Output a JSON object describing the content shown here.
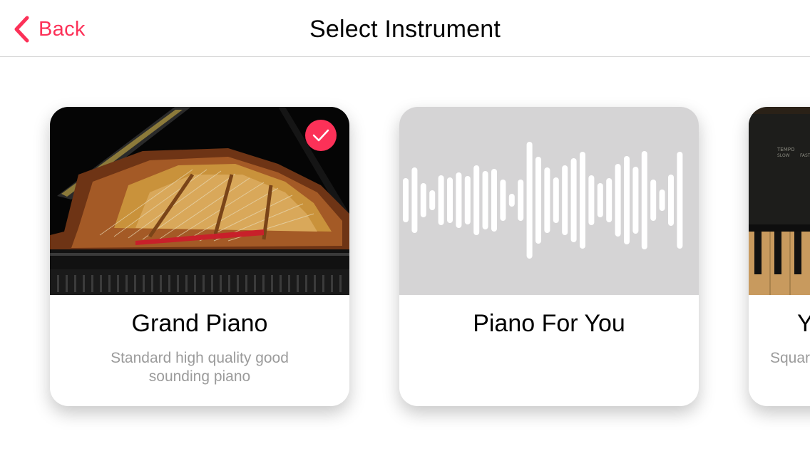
{
  "nav": {
    "back_label": "Back",
    "title": "Select Instrument"
  },
  "cards": [
    {
      "title": "Grand Piano",
      "description": "Standard high quality good sounding piano",
      "media": "grand-piano-photo",
      "selected": true
    },
    {
      "title": "Piano For You",
      "description": "",
      "media": "waveform-icon",
      "selected": false
    },
    {
      "title": "Y",
      "description": "Squar",
      "media": "upright-keyboard-photo",
      "selected": false
    }
  ],
  "colors": {
    "accent": "#fc3158",
    "placeholder_bg": "#d5d4d5",
    "secondary_text": "#9b9b9b"
  }
}
